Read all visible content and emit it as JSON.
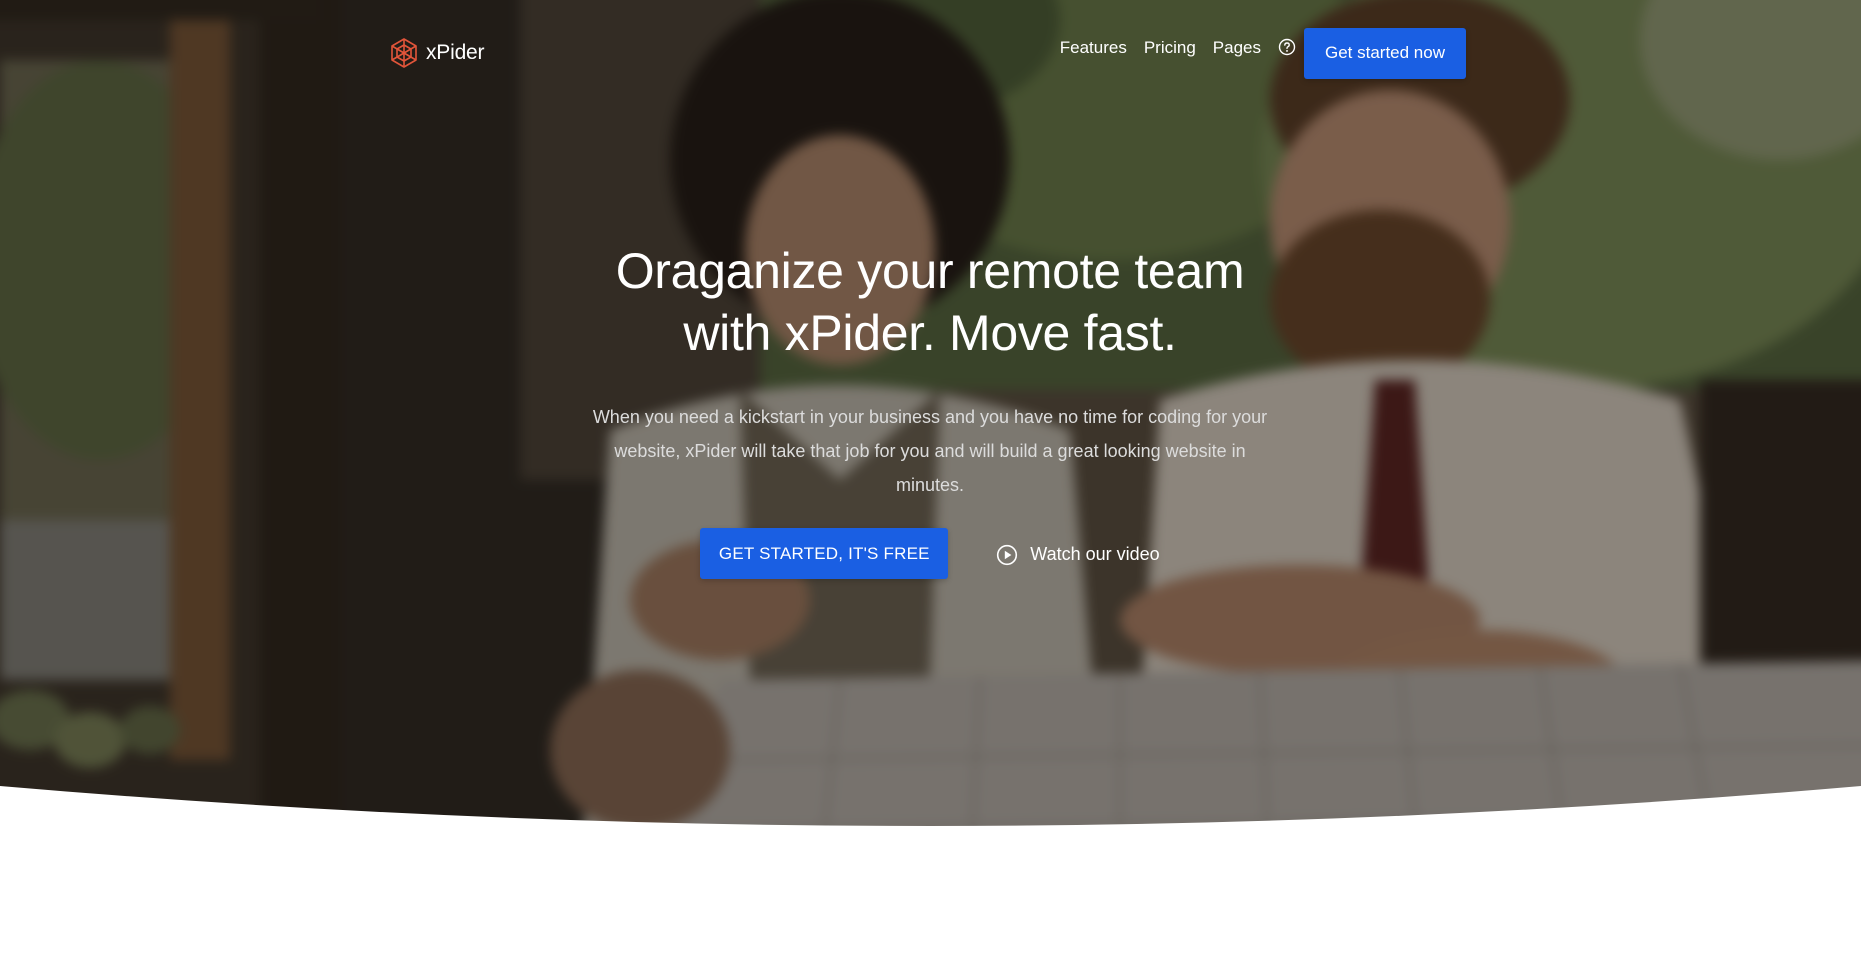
{
  "brand": {
    "name": "xPider",
    "logo_icon": "spider-web-icon",
    "logo_color": "#e2553a"
  },
  "nav": {
    "links": [
      {
        "label": "Features"
      },
      {
        "label": "Pricing"
      },
      {
        "label": "Pages"
      }
    ],
    "help_icon": "question-circle-icon",
    "cta_label": "Get started now"
  },
  "hero": {
    "title_line_1": "Oraganize your remote team",
    "title_line_2": "with xPider. Move fast.",
    "subtitle": "When you need a kickstart in your business and you have no time for coding for your website, xPider will take that job for you and will build a great looking website in minutes.",
    "primary_cta_label": "GET STARTED, IT'S FREE",
    "video_link_label": "Watch our video",
    "video_icon": "play-circle-icon"
  },
  "colors": {
    "accent": "#1a5fe3",
    "brand": "#e2553a",
    "text_on_dark": "#ffffff"
  }
}
